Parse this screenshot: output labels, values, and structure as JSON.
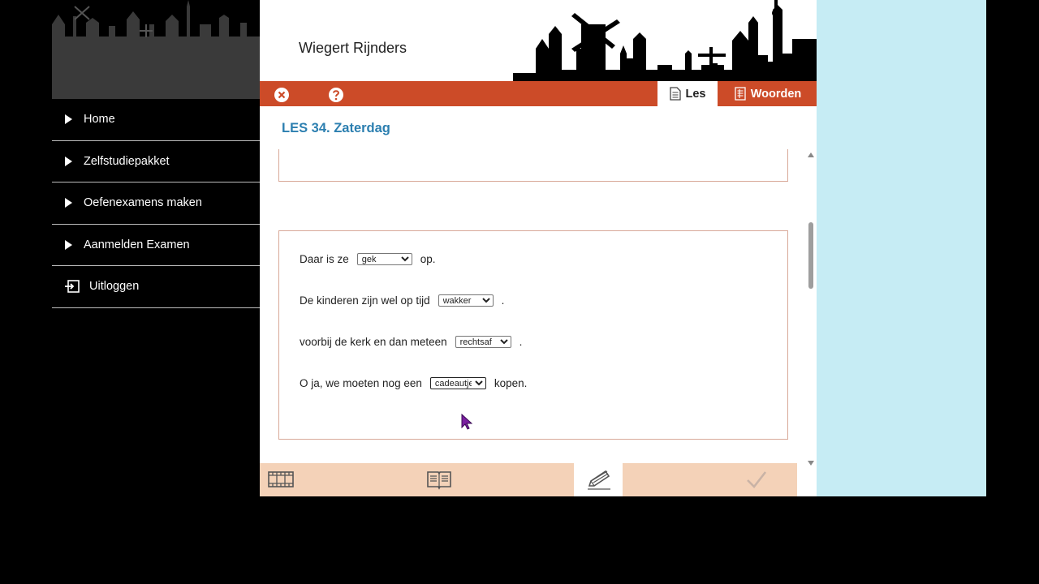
{
  "header": {
    "user_name": "Wiegert Rijnders"
  },
  "sidebar": {
    "items": [
      {
        "label": "Home"
      },
      {
        "label": "Zelfstudiepakket"
      },
      {
        "label": "Oefenexamens maken"
      },
      {
        "label": "Aanmelden Examen"
      },
      {
        "label": "Uitloggen"
      }
    ]
  },
  "toolbar": {
    "close_icon": "close-circle-icon",
    "help_icon": "help-circle-icon",
    "tabs": [
      {
        "label": "Les",
        "icon": "document-icon",
        "active": true
      },
      {
        "label": "Woorden",
        "icon": "list-document-icon",
        "active": false
      }
    ]
  },
  "lesson": {
    "title": "LES 34. Zaterdag"
  },
  "exercise": {
    "sentences": [
      {
        "before": "Daar is ze",
        "selected": "gek",
        "after": "op."
      },
      {
        "before": "De kinderen zijn wel op tijd",
        "selected": "wakker",
        "after": "."
      },
      {
        "before": "voorbij de kerk en dan meteen",
        "selected": "rechtsaf",
        "after": "."
      },
      {
        "before": "O ja, we moeten nog een",
        "selected": "cadeautje",
        "after": "kopen."
      }
    ]
  },
  "bottom_bar": {
    "icons": [
      "film-icon",
      "book-icon",
      "pencil-icon",
      "checkmark-icon"
    ],
    "active": "pencil-icon"
  },
  "colors": {
    "accent": "#cc4b28",
    "title_blue": "#2c7fb0",
    "bottom_bar": "#f4d2b8",
    "right_background": "#c6ecf4"
  }
}
